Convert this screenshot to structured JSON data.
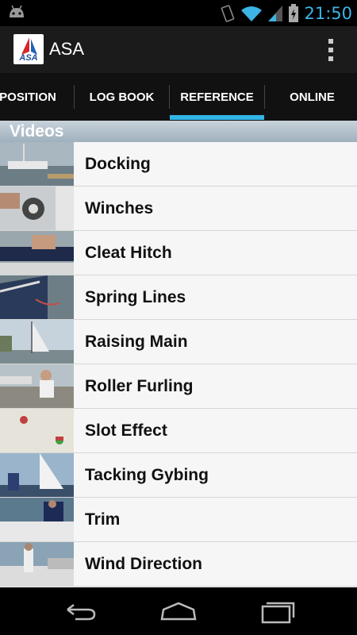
{
  "status": {
    "time": "21:50"
  },
  "app": {
    "title": "ASA",
    "logo_text": "ASA"
  },
  "tabs": [
    {
      "label": "POSITION"
    },
    {
      "label": "LOG BOOK"
    },
    {
      "label": "REFERENCE"
    },
    {
      "label": "ONLINE"
    }
  ],
  "section": {
    "title": "Videos"
  },
  "videos": [
    {
      "title": "Docking"
    },
    {
      "title": "Winches"
    },
    {
      "title": "Cleat Hitch"
    },
    {
      "title": "Spring Lines"
    },
    {
      "title": "Raising Main"
    },
    {
      "title": "Roller Furling"
    },
    {
      "title": "Slot Effect"
    },
    {
      "title": "Tacking Gybing"
    },
    {
      "title": "Trim"
    },
    {
      "title": "Wind Direction"
    }
  ],
  "colors": {
    "accent": "#33b5e5",
    "clock": "#3cb4e5"
  }
}
